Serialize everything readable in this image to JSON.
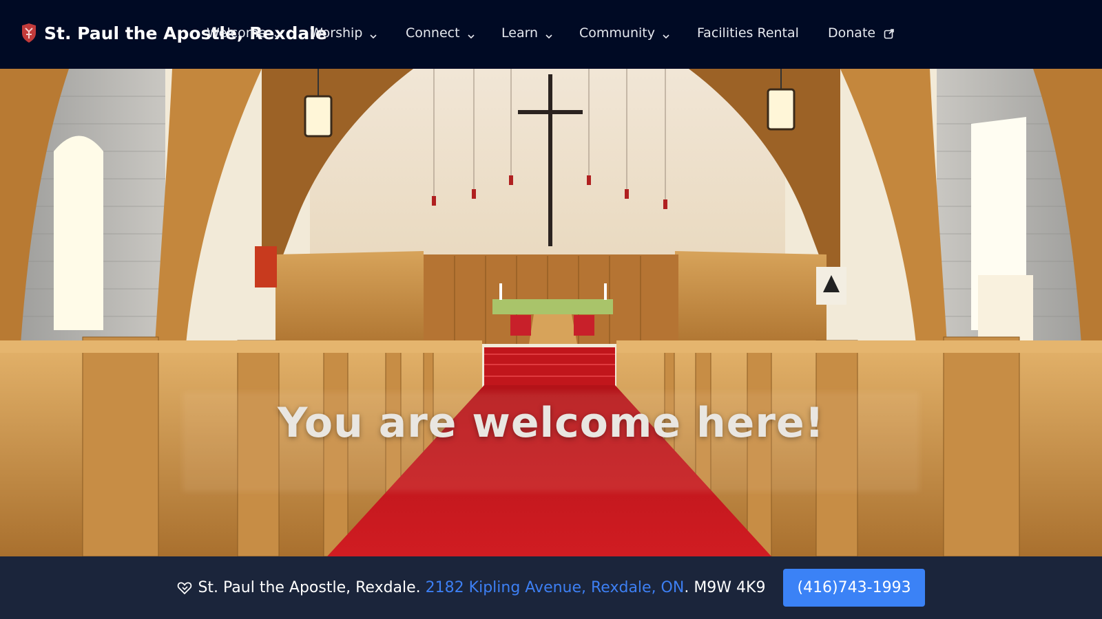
{
  "header": {
    "site_title": "St. Paul the Apostle, Rexdale",
    "logo_icon": "shield-logo-icon",
    "nav": [
      {
        "label": "Welcome",
        "has_dropdown": true
      },
      {
        "label": "Worship",
        "has_dropdown": true
      },
      {
        "label": "Connect",
        "has_dropdown": true
      },
      {
        "label": "Learn",
        "has_dropdown": true
      },
      {
        "label": "Community",
        "has_dropdown": true
      },
      {
        "label": "Facilities Rental",
        "has_dropdown": false
      },
      {
        "label": "Donate",
        "has_dropdown": false,
        "external": true
      }
    ]
  },
  "hero": {
    "heading": "You are welcome here!",
    "image_description_icon": "church-interior-photo"
  },
  "footer": {
    "icon": "heart-handshake-icon",
    "church_name": "St. Paul the Apostle, Rexdale.",
    "address_link": "2182 Kipling Avenue, Rexdale, ON",
    "postal_separator": ".",
    "postal_code": "M9W 4K9",
    "phone_button": "(416)743-1993"
  },
  "colors": {
    "header_bg": "#000a24",
    "footer_bg": "#1b253b",
    "link": "#3d7ff3",
    "button": "#3b82f6",
    "carpet": "#c4141a"
  }
}
